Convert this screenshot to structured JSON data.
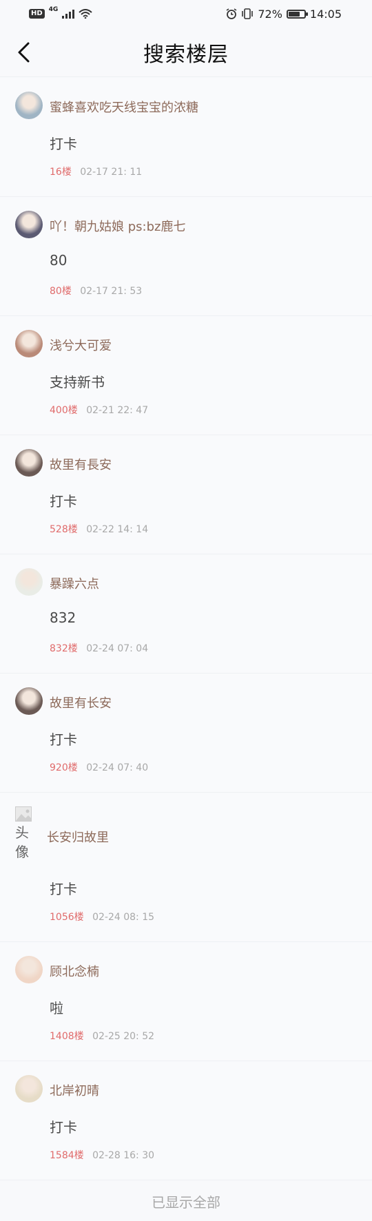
{
  "status_bar": {
    "hd": "HD",
    "network": "4G",
    "battery_text": "72%",
    "battery_level": 0.72,
    "time": "14:05"
  },
  "header": {
    "title": "搜索楼层"
  },
  "items": [
    {
      "nickname": "蜜蜂喜欢吃天线宝宝的浓糖",
      "content": "打卡",
      "floor": "16楼",
      "time": "02-17 21: 11",
      "avatar_color": "#9fb4c4"
    },
    {
      "nickname": "吖！朝九姑娘 ps:bz鹿七",
      "content": "80",
      "floor": "80楼",
      "time": "02-17 21: 53",
      "avatar_color": "#5b5a72"
    },
    {
      "nickname": "浅兮大可爱",
      "content": "支持新书",
      "floor": "400楼",
      "time": "02-21 22: 47",
      "avatar_color": "#b98a78"
    },
    {
      "nickname": "故里有長安",
      "content": "打卡",
      "floor": "528楼",
      "time": "02-22 14: 14",
      "avatar_color": "#6b5a55"
    },
    {
      "nickname": "暴躁六点",
      "content": "832",
      "floor": "832楼",
      "time": "02-24 07: 04",
      "avatar_color": "#e9ece6"
    },
    {
      "nickname": "故里有长安",
      "content": "打卡",
      "floor": "920楼",
      "time": "02-24 07: 40",
      "avatar_color": "#6b5a55"
    }
  ],
  "broken_item": {
    "avatar_alt_line1": "头",
    "avatar_alt_line2": "像",
    "nickname": "长安归故里",
    "content": "打卡",
    "floor": "1056楼",
    "time": "02-24 08: 15"
  },
  "items_after": [
    {
      "nickname": "顾北念楠",
      "content": "啦",
      "floor": "1408楼",
      "time": "02-25 20: 52",
      "avatar_color": "#f0d6c6"
    },
    {
      "nickname": "北岸初晴",
      "content": "打卡",
      "floor": "1584楼",
      "time": "02-28 16: 30",
      "avatar_color": "#e6dcc7"
    }
  ],
  "footer": {
    "text": "已显示全部"
  }
}
